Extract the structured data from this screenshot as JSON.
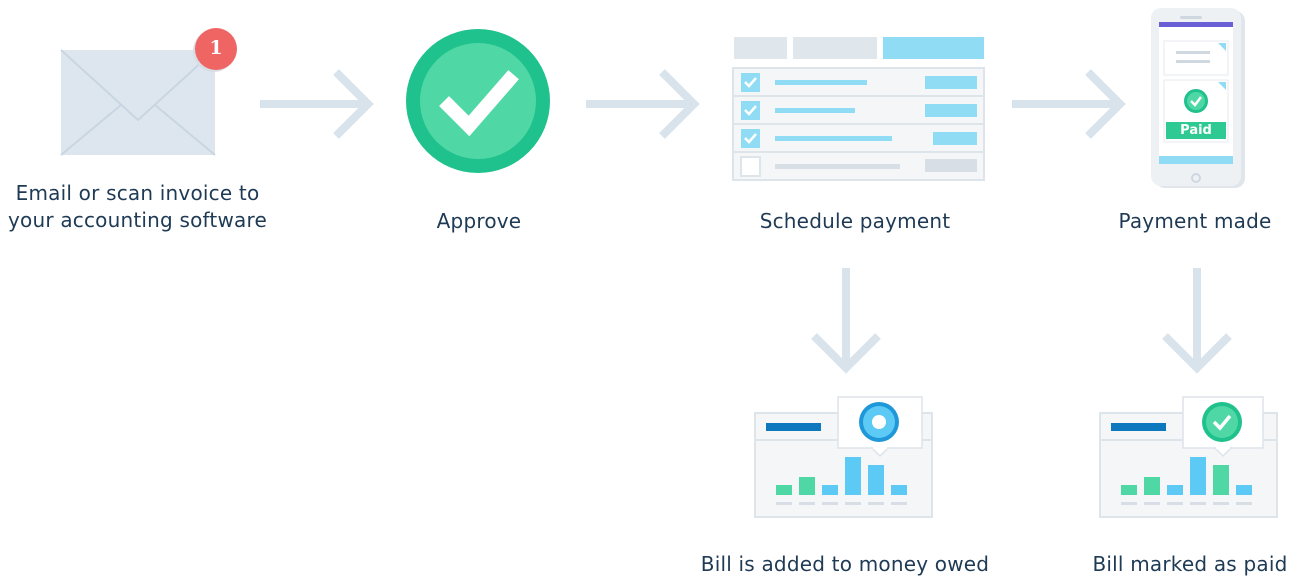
{
  "steps": {
    "email": {
      "caption_line1": "Email or scan invoice to",
      "caption_line2": "your accounting software",
      "badge_count": "1",
      "icon": "envelope-icon"
    },
    "approve": {
      "caption": "Approve",
      "icon": "checkmark-circle-icon"
    },
    "schedule": {
      "caption": "Schedule payment",
      "icon": "checklist-table-icon",
      "rows_checked": 3,
      "rows_total": 4
    },
    "payment_made": {
      "caption": "Payment made",
      "icon": "phone-icon",
      "paid_label": "Paid"
    },
    "money_owed": {
      "caption": "Bill is added to money owed",
      "icon": "dashboard-chart-icon",
      "bars": [
        0.22,
        0.4,
        0.22,
        0.84,
        0.66,
        0.22
      ]
    },
    "marked_paid": {
      "caption": "Bill marked as paid",
      "icon": "dashboard-chart-icon",
      "bars": [
        0.22,
        0.4,
        0.22,
        0.84,
        0.66,
        0.22
      ]
    }
  },
  "colors": {
    "text": "#1e3a55",
    "arrow": "#d8e3ec",
    "green": "#1fc18c",
    "green_light": "#4fd8a6",
    "blue_light": "#8fdcf4",
    "blue": "#42b8ec",
    "navy": "#0d78be",
    "badge": "#ee6564",
    "panel": "#f4f6f8",
    "panel_border": "#dde4ea",
    "purple": "#6a5fd6"
  }
}
